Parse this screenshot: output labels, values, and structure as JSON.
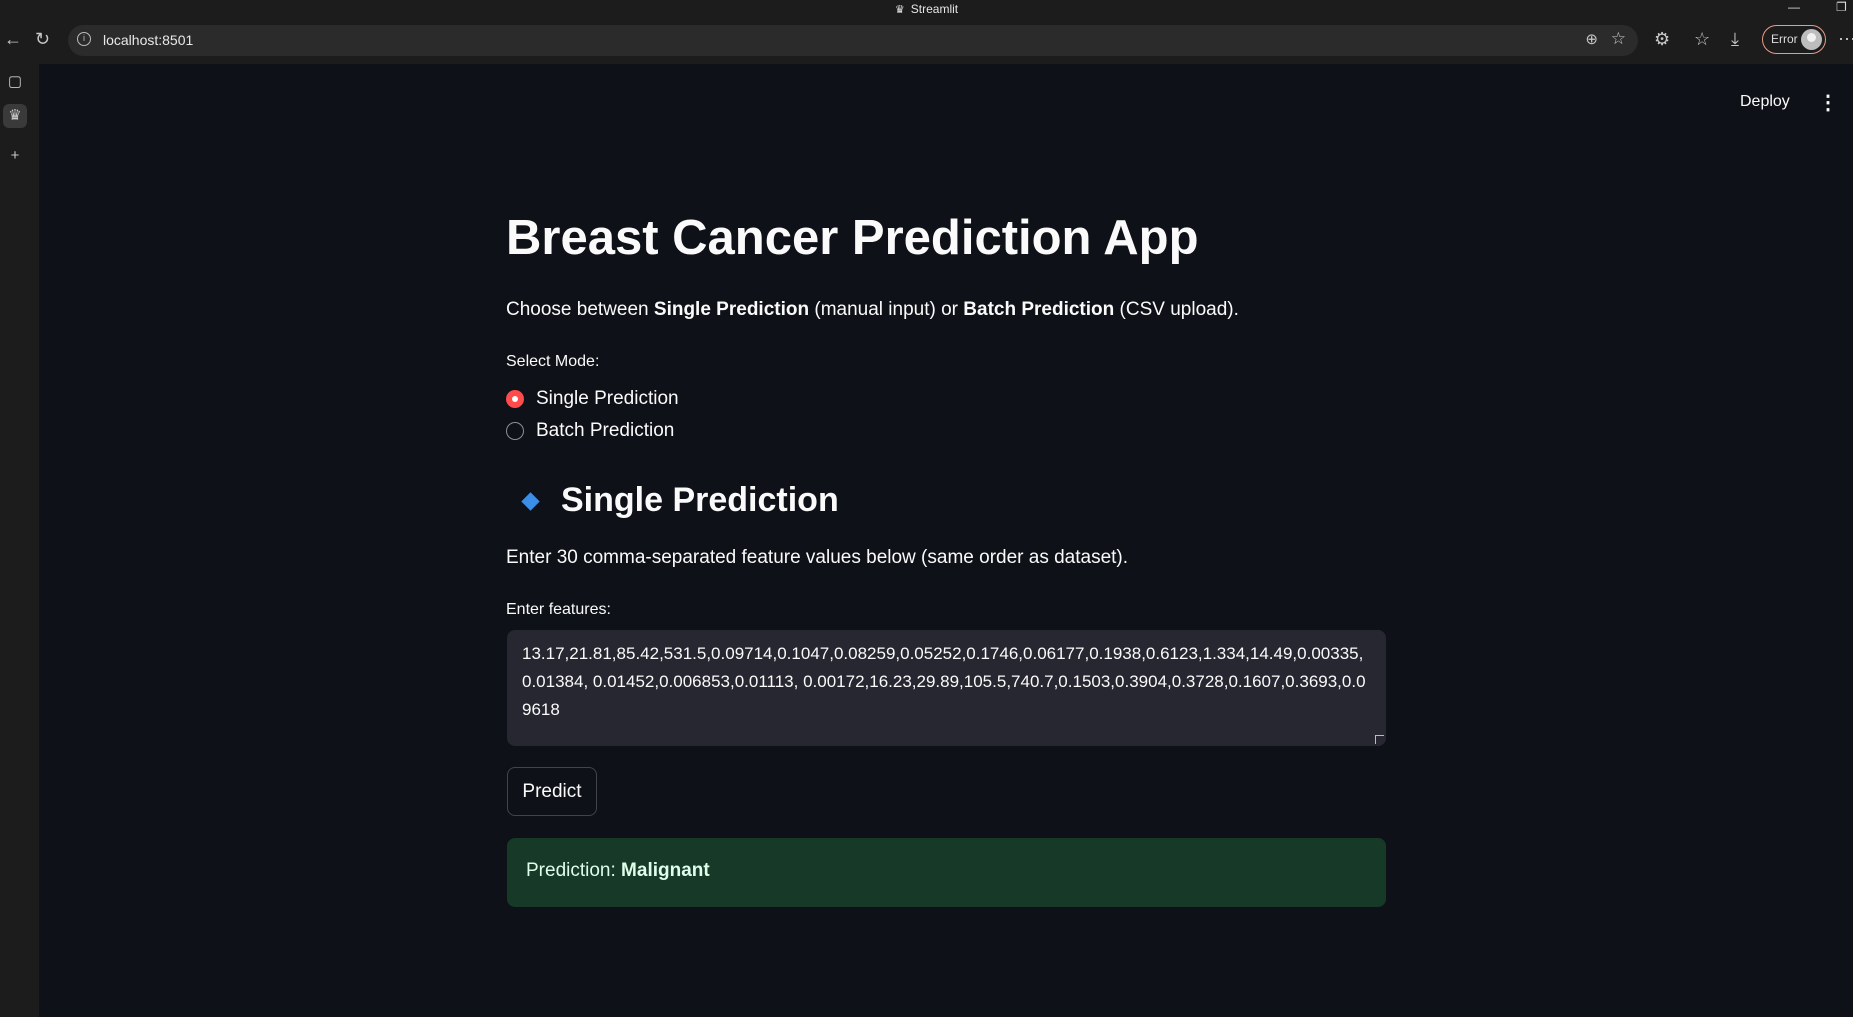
{
  "window": {
    "title": "Streamlit"
  },
  "browser": {
    "url": "localhost:8501",
    "profile_status": "Error"
  },
  "header": {
    "deploy_label": "Deploy"
  },
  "app": {
    "title": "Breast Cancer Prediction App",
    "intro": {
      "prefix": "Choose between ",
      "single": "Single Prediction",
      "middle": " (manual input) or ",
      "batch": "Batch Prediction",
      "suffix": " (CSV upload)."
    },
    "mode_label": "Select Mode:",
    "modes": [
      {
        "label": "Single Prediction",
        "selected": true
      },
      {
        "label": "Batch Prediction",
        "selected": false
      }
    ],
    "section_title": "Single Prediction",
    "instructions": "Enter 30 comma-separated feature values below (same order as dataset).",
    "features_label": "Enter features:",
    "features_value": "13.17,21.81,85.42,531.5,0.09714,0.1047,0.08259,0.05252,0.1746,0.06177,0.1938,0.6123,1.334,14.49,0.00335,0.01384, 0.01452,0.006853,0.01113, 0.00172,16.23,29.89,105.5,740.7,0.1503,0.3904,0.3728,0.1607,0.3693,0.09618",
    "predict_label": "Predict",
    "result_prefix": "Prediction: ",
    "result_value": "Malignant"
  },
  "colors": {
    "background": "#0e1117",
    "accent": "#ff4b4b",
    "success_bg": "#173928",
    "diamond": "#3b8ee8"
  }
}
